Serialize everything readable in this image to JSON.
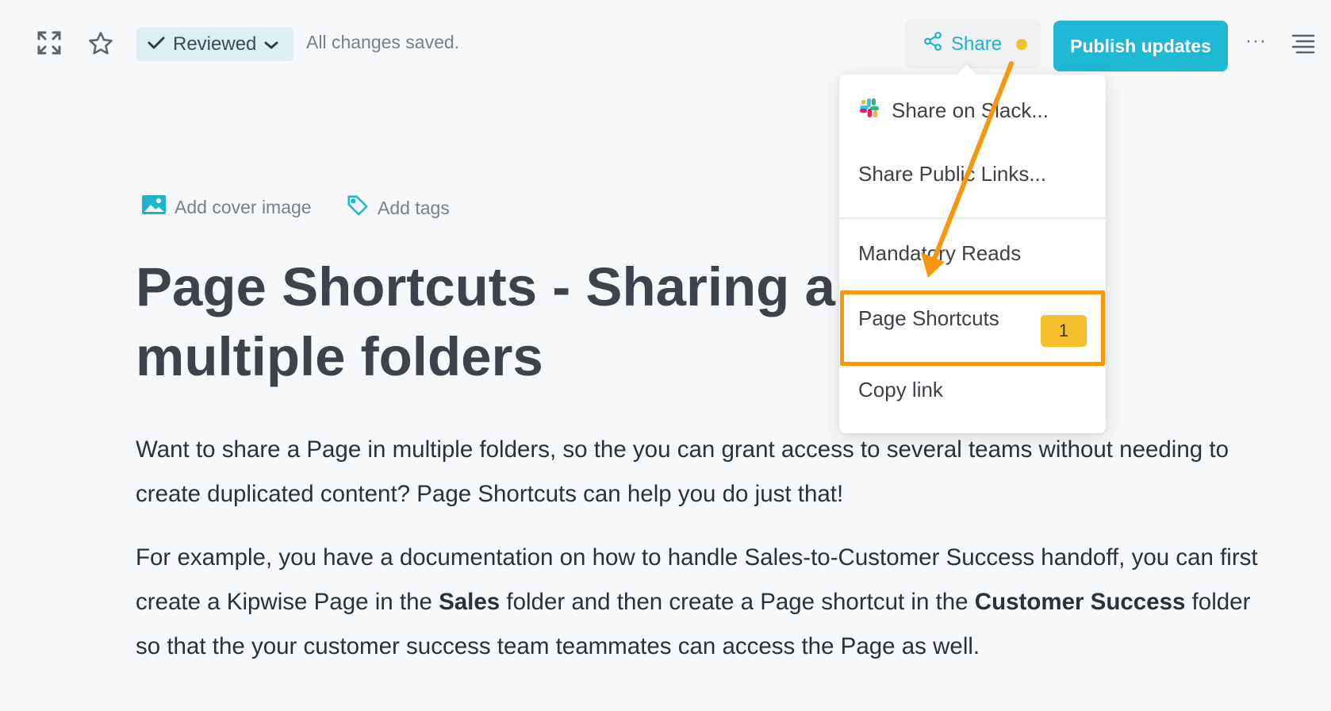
{
  "toolbar": {
    "expand_icon": "expand-icon",
    "star_icon": "star-icon",
    "reviewed_label": "Reviewed",
    "save_status": "All changes saved.",
    "share_label": "Share",
    "publish_label": "Publish updates",
    "more_label": "···"
  },
  "share_menu": {
    "items": [
      {
        "label": "Share on Slack...",
        "icon": "slack-icon"
      },
      {
        "label": "Share Public Links..."
      },
      {
        "label": "Mandatory Reads"
      },
      {
        "label": "Page Shortcuts",
        "badge": "1"
      },
      {
        "label": "Copy link"
      }
    ]
  },
  "page": {
    "add_cover_label": "Add cover image",
    "add_tags_label": "Add tags",
    "title": "Page Shortcuts - Sharing a Page in multiple folders",
    "para1": "Want to share a Page in multiple folders, so the you can grant access to several teams without needing to create duplicated content? Page Shortcuts can help you do just that!",
    "para2": {
      "part1": "For example, you have a documentation on how to handle Sales-to-Customer Success handoff, you can first create a Kipwise Page in the ",
      "bold1": "Sales",
      "part2": " folder and then create a Page shortcut in the ",
      "bold2": "Customer Success",
      "part3": " folder so that the your customer success team teammates can access the Page as well."
    }
  },
  "colors": {
    "accent": "#1fb9d6",
    "highlight": "#f8960c",
    "badge": "#f6c02c"
  }
}
